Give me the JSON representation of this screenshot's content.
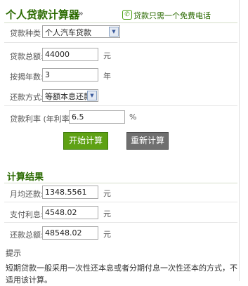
{
  "header": {
    "title": "个人贷款计算器",
    "chevron": "»",
    "phone_icon": "phone-icon",
    "phone_text": "贷款只需一个免费电话"
  },
  "form": {
    "loan_type": {
      "label": "贷款种类：",
      "value": "个人汽车贷款"
    },
    "amount": {
      "label": "贷款总额:",
      "value": "44000",
      "unit": "元"
    },
    "years": {
      "label": "按揭年数:",
      "value": "3",
      "unit": "年"
    },
    "method": {
      "label": "还款方式:",
      "value": "等额本息还款"
    },
    "rate": {
      "label": "贷款利率 (年利率):",
      "value": "6.5",
      "unit": "%"
    },
    "calc_button": "开始计算",
    "reset_button": "重新计算"
  },
  "results": {
    "title": "计算结果",
    "monthly": {
      "label": "月均还款:",
      "value": "1348.5561",
      "unit": "元"
    },
    "interest": {
      "label": "支付利息:",
      "value": "4548.02",
      "unit": "元"
    },
    "total": {
      "label": "还款总额:",
      "value": "48548.02",
      "unit": "元"
    }
  },
  "tips": {
    "title": "提示",
    "text": "短期贷款一般采用一次性还本息或者分期付息一次性还本的方式，不适用该计算。"
  },
  "colors": {
    "title_green": "#2a6a00",
    "calc_button": "#5ea114",
    "reset_button": "#6f6f6f"
  }
}
